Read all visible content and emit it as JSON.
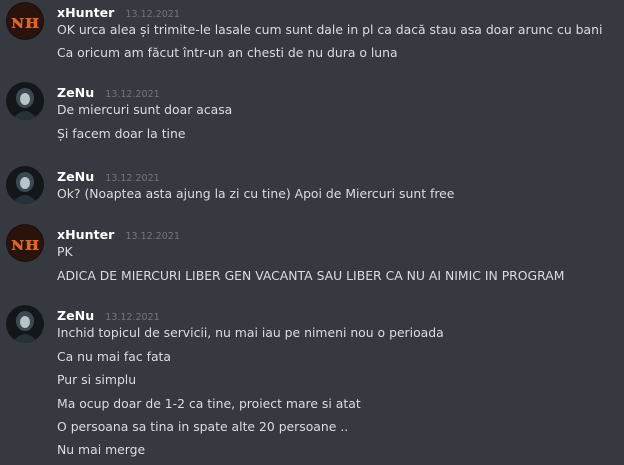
{
  "colors": {
    "background": "#36393f",
    "username": "#ffffff",
    "timestamp": "#72767d",
    "message_text": "#dcddde"
  },
  "messages": [
    {
      "author": "xHunter",
      "avatar_icon": "nh-logo-icon",
      "timestamp": "13.12.2021",
      "lines": [
        "OK urca alea și trimite-le lasale cum sunt dale in pl ca dacă stau asa doar arunc cu bani",
        "Ca oricum am făcut într-un an chesti de nu dura o luna"
      ]
    },
    {
      "author": "ZeNu",
      "avatar_icon": "hooded-figure-icon",
      "timestamp": "13.12.2021",
      "lines": [
        "De miercuri sunt doar acasa",
        "Și facem doar la tine"
      ]
    },
    {
      "author": "ZeNu",
      "avatar_icon": "hooded-figure-icon",
      "timestamp": "13.12.2021",
      "lines": [
        "Ok? (Noaptea asta ajung la zi cu tine) Apoi de Miercuri sunt free"
      ]
    },
    {
      "author": "xHunter",
      "avatar_icon": "nh-logo-icon",
      "timestamp": "13.12.2021",
      "lines": [
        "PK",
        "ADICA DE MIERCURI LIBER GEN VACANTA SAU LIBER CA NU AI NIMIC IN PROGRAM"
      ]
    },
    {
      "author": "ZeNu",
      "avatar_icon": "hooded-figure-icon",
      "timestamp": "13.12.2021",
      "lines": [
        "Inchid topicul de servicii, nu mai iau pe nimeni nou o perioada",
        "Ca nu mai fac fata",
        "Pur si simplu",
        "Ma ocup doar de 1-2 ca tine, proiect mare si atat",
        "O persoana sa tina in spate alte 20 persoane ..",
        "Nu mai merge"
      ]
    }
  ]
}
